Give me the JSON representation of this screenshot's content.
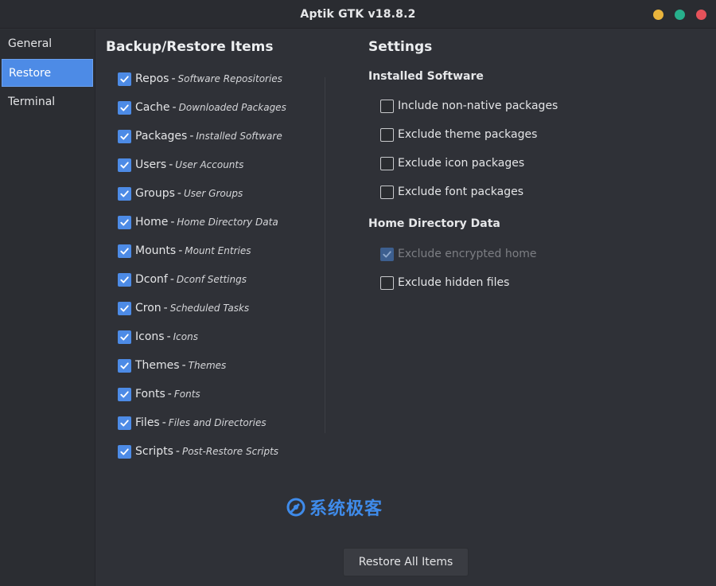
{
  "window": {
    "title": "Aptik GTK v18.8.2",
    "controls": [
      {
        "name": "minimize",
        "color": "#e9b43c"
      },
      {
        "name": "maximize",
        "color": "#27b08c"
      },
      {
        "name": "close",
        "color": "#e5525a"
      }
    ]
  },
  "sidebar": {
    "items": [
      {
        "label": "General",
        "active": false
      },
      {
        "label": "Restore",
        "active": true
      },
      {
        "label": "Terminal",
        "active": false
      }
    ]
  },
  "backup_restore": {
    "title": "Backup/Restore Items",
    "items": [
      {
        "label": "Repos",
        "desc": "Software Repositories",
        "checked": true
      },
      {
        "label": "Cache",
        "desc": "Downloaded Packages",
        "checked": true
      },
      {
        "label": "Packages",
        "desc": "Installed Software",
        "checked": true
      },
      {
        "label": "Users",
        "desc": "User Accounts",
        "checked": true
      },
      {
        "label": "Groups",
        "desc": "User Groups",
        "checked": true
      },
      {
        "label": "Home",
        "desc": "Home Directory Data",
        "checked": true
      },
      {
        "label": "Mounts",
        "desc": "Mount Entries",
        "checked": true
      },
      {
        "label": "Dconf",
        "desc": "Dconf Settings",
        "checked": true
      },
      {
        "label": "Cron",
        "desc": "Scheduled Tasks",
        "checked": true
      },
      {
        "label": "Icons",
        "desc": "Icons",
        "checked": true
      },
      {
        "label": "Themes",
        "desc": "Themes",
        "checked": true
      },
      {
        "label": "Fonts",
        "desc": "Fonts",
        "checked": true
      },
      {
        "label": "Files",
        "desc": "Files and Directories",
        "checked": true
      },
      {
        "label": "Scripts",
        "desc": "Post-Restore Scripts",
        "checked": true
      }
    ]
  },
  "settings": {
    "title": "Settings",
    "installed_software": {
      "title": "Installed Software",
      "options": [
        {
          "label": "Include non-native packages",
          "checked": false
        },
        {
          "label": "Exclude theme packages",
          "checked": false
        },
        {
          "label": "Exclude icon packages",
          "checked": false
        },
        {
          "label": "Exclude font packages",
          "checked": false
        }
      ]
    },
    "home_directory": {
      "title": "Home Directory Data",
      "options": [
        {
          "label": "Exclude encrypted home",
          "checked": true,
          "disabled": true
        },
        {
          "label": "Exclude hidden files",
          "checked": false
        }
      ]
    }
  },
  "watermark": {
    "text": "系统极客"
  },
  "actions": {
    "restore_all_label": "Restore All Items"
  },
  "colors": {
    "accent": "#4d8be6",
    "background": "#2f3137"
  }
}
